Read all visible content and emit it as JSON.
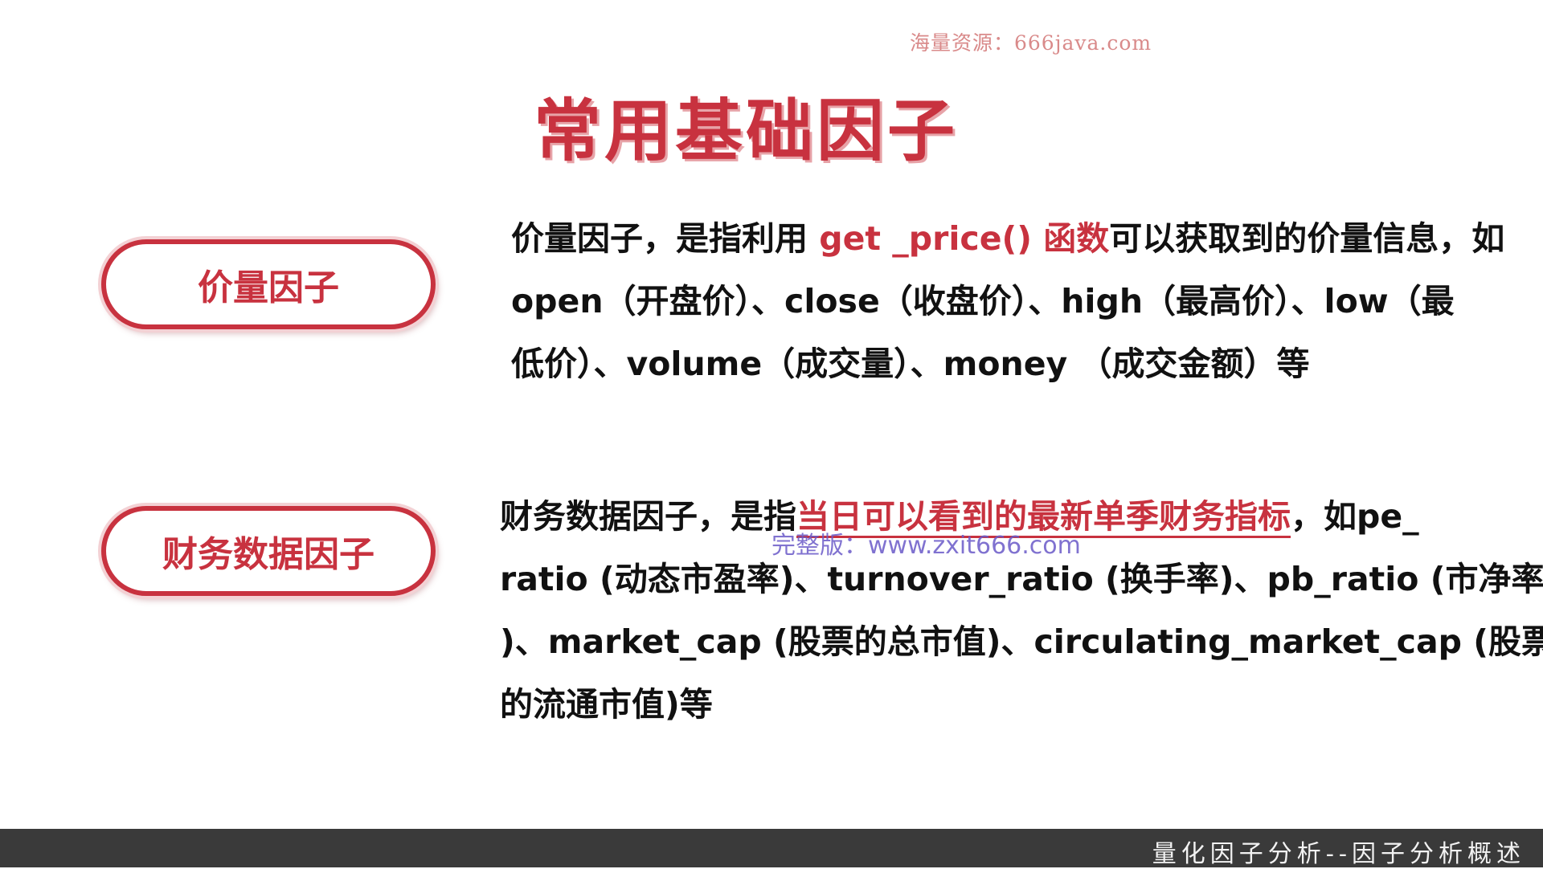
{
  "watermark_top": "海量资源：666java.com",
  "slide": {
    "title": "常用基础因子",
    "items": [
      {
        "label": "价量因子",
        "description_lines": [
          [
            {
              "text": "价量因子，是指利用 "
            },
            {
              "text": "get _price() 函数",
              "style": "highlight"
            },
            {
              "text": "可以获取到的价量信息，如"
            }
          ],
          [
            {
              "text": "open（开盘价）、close（收盘价）、high（最高价）、low（最"
            }
          ],
          [
            {
              "text": "低价）、volume（成交量）、money （成交金额）等"
            }
          ]
        ]
      },
      {
        "label": "财务数据因子",
        "description_lines": [
          [
            {
              "text": "财务数据因子，是指"
            },
            {
              "text": "当日可以看到的最新单季财务指标",
              "style": "highlight-underline"
            },
            {
              "text": "，如pe_"
            }
          ],
          [
            {
              "text": "ratio (动态市盈率)、turnover_ratio (换手率)、pb_ratio (市净率"
            }
          ],
          [
            {
              "text": ")、market_cap (股票的总市值)、circulating_market_cap (股票"
            }
          ],
          [
            {
              "text": "的流通市值)等"
            }
          ]
        ]
      }
    ]
  },
  "watermark_mid": "完整版：www.zxit666.com",
  "footer": {
    "title": "量化因子分析--因子分析概述"
  },
  "colors": {
    "accent": "#c8323f",
    "text": "#111111",
    "footer_bg": "#3a3a3a",
    "footer_text": "#f2f2f2"
  }
}
